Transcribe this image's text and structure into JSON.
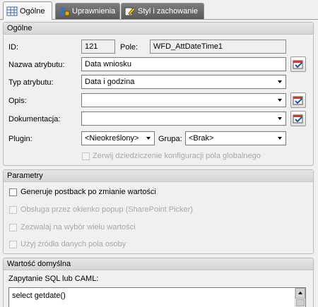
{
  "tabs": [
    {
      "label": "Ogólne",
      "icon": "grid-icon",
      "active": true
    },
    {
      "label": "Uprawnienia",
      "icon": "users-lock-icon",
      "active": false
    },
    {
      "label": "Styl i zachowanie",
      "icon": "pencil-edit-icon",
      "active": false
    }
  ],
  "general": {
    "title": "Ogólne",
    "id_label": "ID:",
    "id_value": "121",
    "pole_label": "Pole:",
    "pole_value": "WFD_AttDateTime1",
    "name_label": "Nazwa atrybutu:",
    "name_value": "Data wniosku",
    "type_label": "Typ atrybutu:",
    "type_value": "Data i godzina",
    "desc_label": "Opis:",
    "desc_value": "",
    "doc_label": "Dokumentacja:",
    "doc_value": "",
    "plugin_label": "Plugin:",
    "plugin_value": "<Nieokreślony>",
    "group_label": "Grupa:",
    "group_value": "<Brak>",
    "inherit_label": "Zerwij dziedziczenie konfiguracji pola globalnego"
  },
  "params": {
    "title": "Parametry",
    "options": [
      {
        "label": "Generuje postback po zmianie wartości",
        "enabled": true,
        "checked": false
      },
      {
        "label": "Obsługa przez okienko popup (SharePoint Picker)",
        "enabled": false,
        "checked": false
      },
      {
        "label": "Zezwalaj na wybór wielu wartości",
        "enabled": false,
        "checked": false
      },
      {
        "label": "Użyj źródła danych pola osoby",
        "enabled": false,
        "checked": false
      }
    ]
  },
  "default_value": {
    "title": "Wartość domyślna",
    "query_label": "Zapytanie SQL lub CAML:",
    "query_value": "select getdate()"
  }
}
